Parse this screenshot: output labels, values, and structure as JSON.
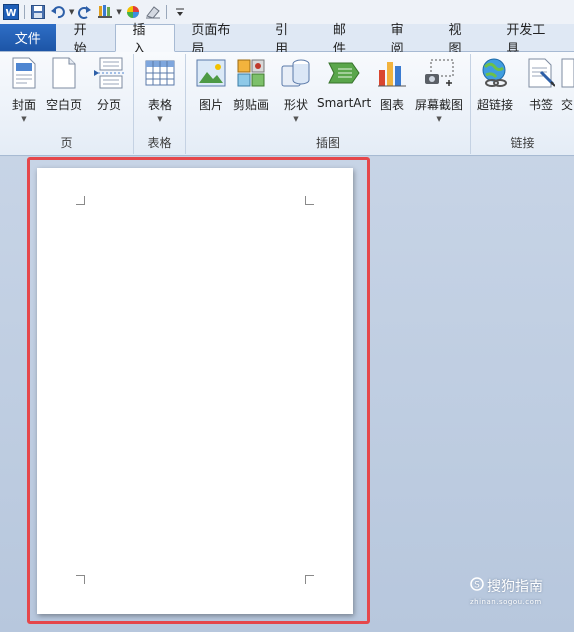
{
  "quick_access": {
    "icons": [
      "word-app-icon",
      "save-icon",
      "undo-icon",
      "redo-icon",
      "format-painter-icon",
      "color-wheel-icon",
      "eraser-icon",
      "customize-icon"
    ]
  },
  "tabs": {
    "file": "文件",
    "items": [
      "开始",
      "插入",
      "页面布局",
      "引用",
      "邮件",
      "审阅",
      "视图",
      "开发工具"
    ],
    "active": "插入"
  },
  "ribbon": {
    "groups": {
      "pages": {
        "label": "页",
        "buttons": [
          {
            "label": "封面",
            "icon": "cover-page-icon",
            "dropdown": true
          },
          {
            "label": "空白页",
            "icon": "blank-page-icon",
            "dropdown": false
          },
          {
            "label": "分页",
            "icon": "page-break-icon",
            "dropdown": false
          }
        ]
      },
      "tables": {
        "label": "表格",
        "buttons": [
          {
            "label": "表格",
            "icon": "table-icon",
            "dropdown": true
          }
        ]
      },
      "illustrations": {
        "label": "插图",
        "buttons": [
          {
            "label": "图片",
            "icon": "picture-icon",
            "dropdown": false
          },
          {
            "label": "剪贴画",
            "icon": "clip-art-icon",
            "dropdown": false
          },
          {
            "label": "形状",
            "icon": "shapes-icon",
            "dropdown": true
          },
          {
            "label": "SmartArt",
            "icon": "smartart-icon",
            "dropdown": false
          },
          {
            "label": "图表",
            "icon": "chart-icon",
            "dropdown": false
          },
          {
            "label": "屏幕截图",
            "icon": "screenshot-icon",
            "dropdown": true
          }
        ]
      },
      "links": {
        "label": "链接",
        "buttons": [
          {
            "label": "超链接",
            "icon": "hyperlink-icon",
            "dropdown": false
          },
          {
            "label": "书签",
            "icon": "bookmark-icon",
            "dropdown": false
          },
          {
            "label": "交",
            "icon": "cross-reference-icon",
            "dropdown": false
          }
        ]
      }
    }
  },
  "watermark": {
    "main": "搜狗指南",
    "sub": "zhinan.sogou.com"
  },
  "colors": {
    "file_tab": "#1d55a6",
    "highlight": "#e5474b",
    "doc_background": "#c6d3e4"
  }
}
